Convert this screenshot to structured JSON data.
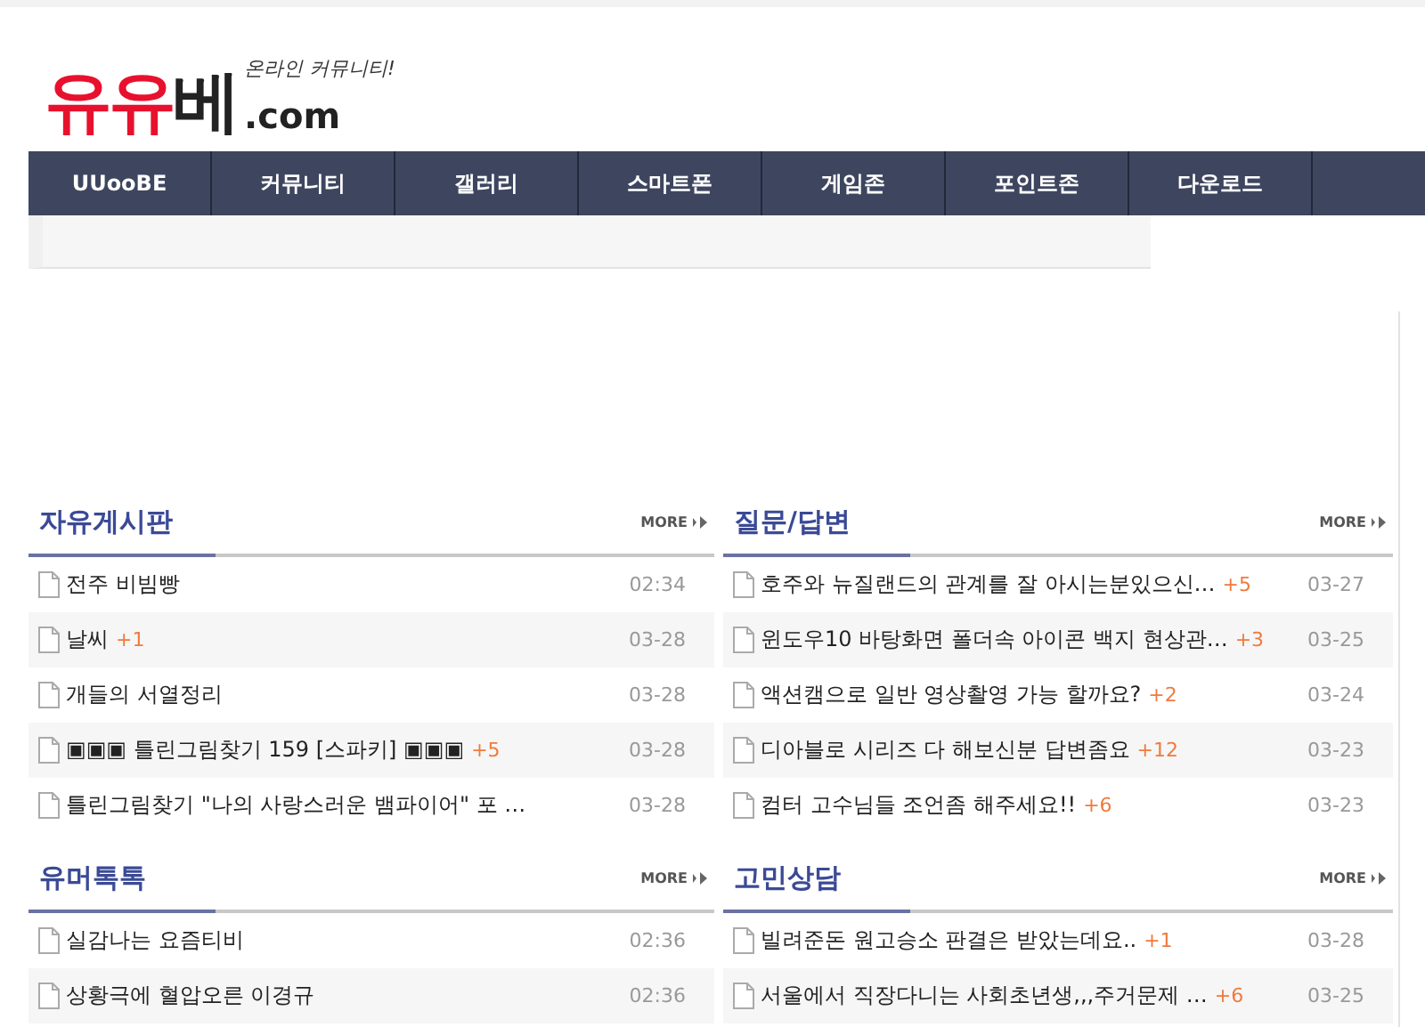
{
  "logo": {
    "red_part": "유유",
    "dark_part": "베",
    "domain": ".com",
    "tagline": "온라인 커뮤니티!"
  },
  "nav": [
    {
      "label": "UUooBE"
    },
    {
      "label": "커뮤니티"
    },
    {
      "label": "갤러리"
    },
    {
      "label": "스마트폰"
    },
    {
      "label": "게임존"
    },
    {
      "label": "포인트존"
    },
    {
      "label": "다운로드"
    }
  ],
  "boards": [
    {
      "title": "자유게시판",
      "more": "MORE",
      "posts": [
        {
          "title": "전주 비빔빵",
          "time": "02:34"
        },
        {
          "title": "날씨",
          "comments": "+1",
          "time": "03-28"
        },
        {
          "title": "개들의 서열정리",
          "time": "03-28"
        },
        {
          "title": "▣▣▣ 틀린그림찾기 159 [스파키] ▣▣▣",
          "comments": "+5",
          "time": "03-28"
        },
        {
          "title": "틀린그림찾기 \"나의 사랑스러운 뱀파이어\" 포 …",
          "time": "03-28"
        }
      ]
    },
    {
      "title": "질문/답변",
      "more": "MORE",
      "posts": [
        {
          "title": "호주와 뉴질랜드의 관계를 잘 아시는분있으신…",
          "comments": "+5",
          "time": "03-27"
        },
        {
          "title": "윈도우10 바탕화면 폴더속 아이콘 백지 현상관…",
          "comments": "+3",
          "time": "03-25"
        },
        {
          "title": "액션캠으로 일반 영상촬영 가능 할까요?",
          "comments": "+2",
          "time": "03-24"
        },
        {
          "title": "디아블로 시리즈 다 해보신분 답변좀요",
          "comments": "+12",
          "time": "03-23"
        },
        {
          "title": "컴터 고수님들 조언좀 해주세요!!",
          "comments": "+6",
          "time": "03-23"
        }
      ]
    },
    {
      "title": "유머톡톡",
      "more": "MORE",
      "posts": [
        {
          "title": "실감나는 요즘티비",
          "time": "02:36"
        },
        {
          "title": "상황극에 혈압오른 이경규",
          "time": "02:36"
        }
      ]
    },
    {
      "title": "고민상담",
      "more": "MORE",
      "posts": [
        {
          "title": "빌려준돈 원고승소 판결은 받았는데요..",
          "comments": "+1",
          "time": "03-28"
        },
        {
          "title": "서울에서 직장다니는 사회초년생,,,주거문제 …",
          "comments": "+6",
          "time": "03-25"
        }
      ]
    }
  ]
}
